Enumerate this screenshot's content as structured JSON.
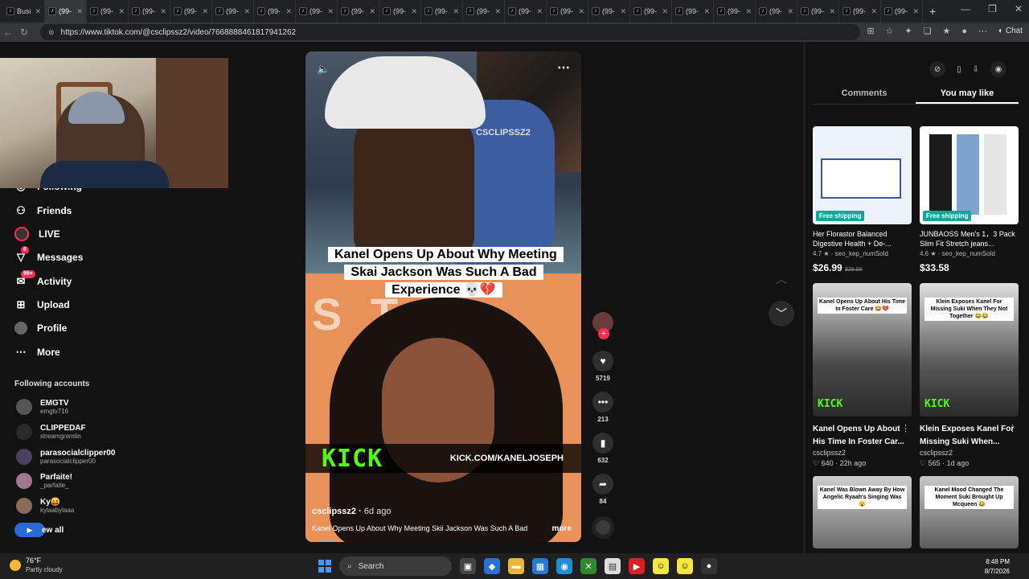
{
  "browser": {
    "tabs": [
      {
        "label": "Busi",
        "active": false
      },
      {
        "label": "(99-",
        "active": true
      },
      {
        "label": "(99-",
        "active": false
      },
      {
        "label": "(99-",
        "active": false
      },
      {
        "label": "(99-",
        "active": false
      },
      {
        "label": "(99-",
        "active": false
      },
      {
        "label": "(99-",
        "active": false
      },
      {
        "label": "(99-",
        "active": false
      },
      {
        "label": "(99-",
        "active": false
      },
      {
        "label": "(99-",
        "active": false
      },
      {
        "label": "(99-",
        "active": false
      },
      {
        "label": "(99-",
        "active": false
      },
      {
        "label": "(99-",
        "active": false
      },
      {
        "label": "(99-",
        "active": false
      },
      {
        "label": "(99-",
        "active": false
      },
      {
        "label": "(99-",
        "active": false
      },
      {
        "label": "(99-",
        "active": false
      },
      {
        "label": "(99-",
        "active": false
      },
      {
        "label": "(99-",
        "active": false
      },
      {
        "label": "(99-",
        "active": false
      },
      {
        "label": "(99-",
        "active": false
      },
      {
        "label": "(99-",
        "active": false
      }
    ],
    "url": "https://www.tiktok.com/@csclipssz2/video/7668888461817941262",
    "chat_label": "Chat"
  },
  "sidebar": {
    "items": [
      {
        "label": "Following",
        "icon": "following-icon"
      },
      {
        "label": "Friends",
        "icon": "friends-icon"
      },
      {
        "label": "LIVE",
        "icon": "live-icon"
      },
      {
        "label": "Messages",
        "icon": "messages-icon",
        "badge": "6"
      },
      {
        "label": "Activity",
        "icon": "activity-icon",
        "badge": "99+"
      },
      {
        "label": "Upload",
        "icon": "upload-icon"
      },
      {
        "label": "Profile",
        "icon": "profile-icon"
      },
      {
        "label": "More",
        "icon": "more-icon"
      }
    ],
    "following_title": "Following accounts",
    "accounts": [
      {
        "name": "EMGTV",
        "handle": "emgtv716"
      },
      {
        "name": "CLIPPEDAF",
        "handle": "streamgremlin"
      },
      {
        "name": "parasocialclipper00",
        "handle": "parasocialclipper00"
      },
      {
        "name": "Parfaite!",
        "handle": "_parfaite_"
      },
      {
        "name": "Ky😝",
        "handle": "kylaabylaaa"
      }
    ],
    "see_all": "ew all"
  },
  "video": {
    "caption": "Kanel Opens Up About Why Meeting Skai Jackson Was Such A Bad Experience 💀💔",
    "watermark": "CSCLIPSSZ2",
    "kick_logo": "KICK",
    "kick_url": "KICK.COM/KANELJOSEPH",
    "username": "csclipssz2",
    "ago": "6d ago",
    "description": "Kanel Opens Up About Why Meeting Skii Jackson Was Such A Bad",
    "more_label": "more",
    "likes": "5719",
    "comments": "213",
    "saves": "632",
    "shares": "84"
  },
  "right_panel": {
    "tabs": [
      {
        "label": "Comments",
        "active": false
      },
      {
        "label": "You may like",
        "active": true
      }
    ],
    "products": [
      {
        "title": "Her Florastor Balanced Digestive Health + De-...",
        "rating": "4.7 ★ · seo_kep_numSold",
        "price": "$26.99",
        "old_price": "$29.99",
        "shipping": "Free shipping"
      },
      {
        "title": "JUNBAOSS Men's 1，3 Pack Slim Fit Stretch jeans...",
        "rating": "4.6 ★ · seo_kep_numSold",
        "price": "$33.58",
        "old_price": "",
        "shipping": "Free shipping"
      }
    ],
    "videos": [
      {
        "title": "Kanel Opens Up About His Time In Foster Car...",
        "author": "csclipssz2",
        "stats": "♡ 640 · 22h ago",
        "thumb_caption": "Kanel Opens Up About His Time In Foster Care 😂💔"
      },
      {
        "title": "Klein Exposes Kanel For Missing Suki When...",
        "author": "csclipssz2",
        "stats": "♡ 565 · 1d ago",
        "thumb_caption": "Klein Exposes Kanel For Missing Suki When They Not Together 😂😂"
      },
      {
        "title": "",
        "author": "",
        "stats": "",
        "thumb_caption": "Kanel Was Blown Away By How Angelic Ryaah's Singing Was 😮"
      },
      {
        "title": "",
        "author": "",
        "stats": "",
        "thumb_caption": "Kanel Mood Changed The Moment Suki Brought Up Mcqueen 😂"
      }
    ]
  },
  "taskbar": {
    "temp": "76°F",
    "weather": "Partly cloudy",
    "search_label": "Search",
    "time": "8:48 PM",
    "date": "8/7/2026"
  },
  "colors": {
    "accent": "#fe2c55",
    "kick_green": "#53fc18",
    "background": "#121212"
  }
}
